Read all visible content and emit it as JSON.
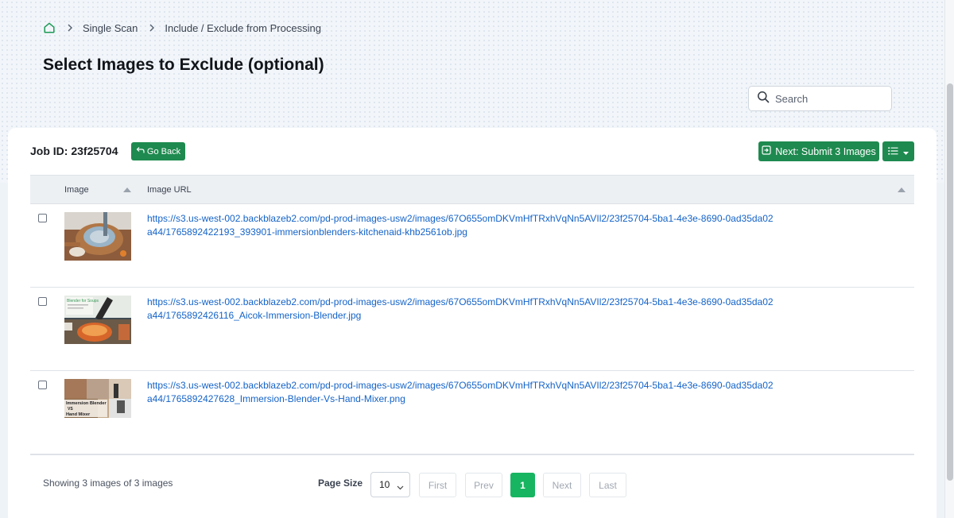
{
  "breadcrumb": {
    "items": [
      "Single Scan",
      "Include / Exclude from Processing"
    ]
  },
  "page_title": "Select Images to Exclude (optional)",
  "search": {
    "placeholder": "Search"
  },
  "job": {
    "label": "Job ID: 23f25704"
  },
  "toolbar": {
    "go_back": "Go Back",
    "next_submit": "Next: Submit 3 Images"
  },
  "table": {
    "headers": {
      "image": "Image",
      "url": "Image URL"
    },
    "rows": [
      {
        "url": "https://s3.us-west-002.backblazeb2.com/pd-prod-images-usw2/images/67O655omDKVmHfTRxhVqNn5AVIl2/23f25704-5ba1-4e3e-8690-0ad35da02a44/1765892422193_393901-immersionblenders-kitchenaid-khb2561ob.jpg"
      },
      {
        "url": "https://s3.us-west-002.backblazeb2.com/pd-prod-images-usw2/images/67O655omDKVmHfTRxhVqNn5AVIl2/23f25704-5ba1-4e3e-8690-0ad35da02a44/1765892426116_Aicok-Immersion-Blender.jpg",
        "thumb_text": "Blender for Soups"
      },
      {
        "url": "https://s3.us-west-002.backblazeb2.com/pd-prod-images-usw2/images/67O655omDKVmHfTRxhVqNn5AVIl2/23f25704-5ba1-4e3e-8690-0ad35da02a44/1765892427628_Immersion-Blender-Vs-Hand-Mixer.png",
        "thumb_text": [
          "Immersion Blender",
          "VS",
          "Hand Mixer"
        ]
      }
    ]
  },
  "footer": {
    "showing": "Showing 3 images of 3 images",
    "page_size_label": "Page Size",
    "page_size_value": "10",
    "first": "First",
    "prev": "Prev",
    "current_page": "1",
    "next": "Next",
    "last": "Last"
  },
  "colors": {
    "primary_green": "#1e8a4f",
    "active_page": "#17b561",
    "link_blue": "#1463c8"
  }
}
